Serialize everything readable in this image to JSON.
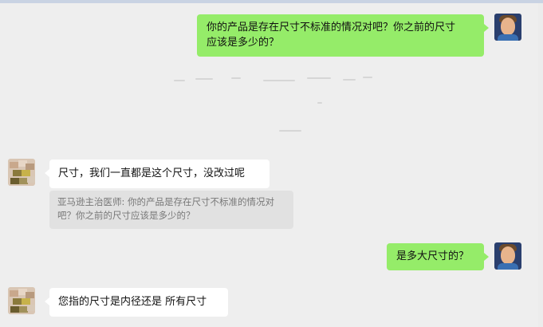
{
  "messages": [
    {
      "side": "right",
      "text_lines": [
        "你的产品是存在尺寸不标准的情况对吧？你之前的尺寸",
        "应该是多少的？"
      ]
    },
    {
      "side": "left",
      "text": "尺寸，我们一直都是这个尺寸，没改过呢",
      "quote_lines": [
        "亚马逊主治医师: 你的产品是存在尺寸不标准的情况对",
        "吧？你之前的尺寸应该是多少的？"
      ]
    },
    {
      "side": "right",
      "text": "是多大尺寸的？"
    },
    {
      "side": "left",
      "text": "您指的尺寸是内径还是 所有尺寸"
    }
  ],
  "icons": {
    "self_avatar": "user-avatar-icon",
    "contact_avatar": "contact-avatar-icon"
  },
  "colors": {
    "sent_bubble": "#95ec69",
    "received_bubble": "#ffffff",
    "background": "#eeeeee",
    "quote_bg": "#e1e1e1"
  }
}
